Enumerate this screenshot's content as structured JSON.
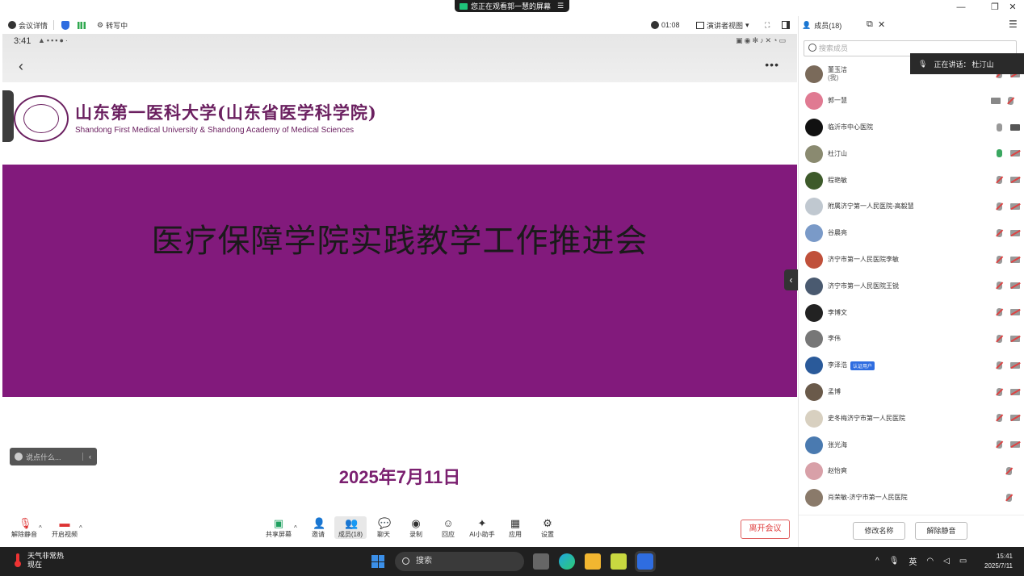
{
  "window": {
    "share_banner": "您正在观看郭一慧的屏幕",
    "minimize": "—",
    "restore": "❐",
    "close": "✕"
  },
  "toolbar": {
    "meeting_info": "会议详情",
    "network": "转写中",
    "timer": "01:08",
    "view_mode": "演讲者视图"
  },
  "phone": {
    "time": "3:41",
    "left_icons": "▲▪▪▪●·",
    "right_icons": "▣◉✻♪✕◔▭"
  },
  "slide": {
    "school_cn": "山东第一医科大学(山东省医学科学院)",
    "school_en": "Shandong First Medical University & Shandong Academy of Medical Sciences",
    "title": "医疗保障学院实践教学工作推进会",
    "date": "2025年7月11日"
  },
  "chat": {
    "placeholder": "说点什么..."
  },
  "controls": {
    "unmute": "解除静音",
    "start_video": "开启视频",
    "share_screen": "共享屏幕",
    "invite": "邀请",
    "members": "成员(18)",
    "chat": "聊天",
    "record": "录制",
    "reactions": "回应",
    "ai_assistant": "AI小助手",
    "apps": "应用",
    "settings": "设置",
    "leave": "离开会议"
  },
  "panel": {
    "title": "成员(18)",
    "search_placeholder": "搜索成员",
    "speaking_label": "正在讲话：",
    "speaking_name": "杜汀山",
    "rename": "修改名称",
    "unmute": "解除静音"
  },
  "members": [
    {
      "name": "董玉洁",
      "sub": "(我)",
      "color": "#7a6a5a",
      "mic": "muted",
      "cam": "off"
    },
    {
      "name": "郭一慧",
      "sub": "",
      "color": "#e07a92",
      "mic": "muted",
      "cam": "share"
    },
    {
      "name": "临沂市中心医院",
      "sub": "",
      "color": "#111111",
      "mic": "plain",
      "cam": "on"
    },
    {
      "name": "杜汀山",
      "sub": "",
      "color": "#8a8a70",
      "mic": "on",
      "cam": "off"
    },
    {
      "name": "程艳敏",
      "sub": "",
      "color": "#3d5a2a",
      "mic": "muted",
      "cam": "off"
    },
    {
      "name": "附属济宁第一人民医院-高毅慧",
      "sub": "",
      "color": "#c0c8d0",
      "mic": "muted",
      "cam": "off"
    },
    {
      "name": "谷晨亮",
      "sub": "",
      "color": "#7a9ac8",
      "mic": "muted",
      "cam": "off"
    },
    {
      "name": "济宁市第一人民医院李敏",
      "sub": "",
      "color": "#c0503a",
      "mic": "muted",
      "cam": "off"
    },
    {
      "name": "济宁市第一人民医院王锐",
      "sub": "",
      "color": "#4a5a70",
      "mic": "muted",
      "cam": "off"
    },
    {
      "name": "李博文",
      "sub": "",
      "color": "#222222",
      "mic": "muted",
      "cam": "off"
    },
    {
      "name": "李伟",
      "sub": "",
      "color": "#777777",
      "mic": "muted",
      "cam": "off"
    },
    {
      "name": "李泽浩",
      "sub": "",
      "badge": "认证用户",
      "color": "#2a5a9a",
      "mic": "muted",
      "cam": "off"
    },
    {
      "name": "孟博",
      "sub": "",
      "color": "#6a5a4a",
      "mic": "muted",
      "cam": "off"
    },
    {
      "name": "史冬梅济宁市第一人民医院",
      "sub": "",
      "color": "#d8d0c0",
      "mic": "muted",
      "cam": "off"
    },
    {
      "name": "张光海",
      "sub": "",
      "color": "#4a7ab0",
      "mic": "muted",
      "cam": "off"
    },
    {
      "name": "赵怡爽",
      "sub": "",
      "color": "#d8a0a8",
      "mic": "muted",
      "cam": "none"
    },
    {
      "name": "肖荣敏-济宁市第一人民医院",
      "sub": "",
      "color": "#8a7a6a",
      "mic": "muted",
      "cam": "none"
    }
  ],
  "taskbar": {
    "weather_title": "天气非常热",
    "weather_sub": "现在",
    "search_placeholder": "搜索",
    "ime": "英",
    "time": "15:41",
    "date": "2025/7/11"
  }
}
